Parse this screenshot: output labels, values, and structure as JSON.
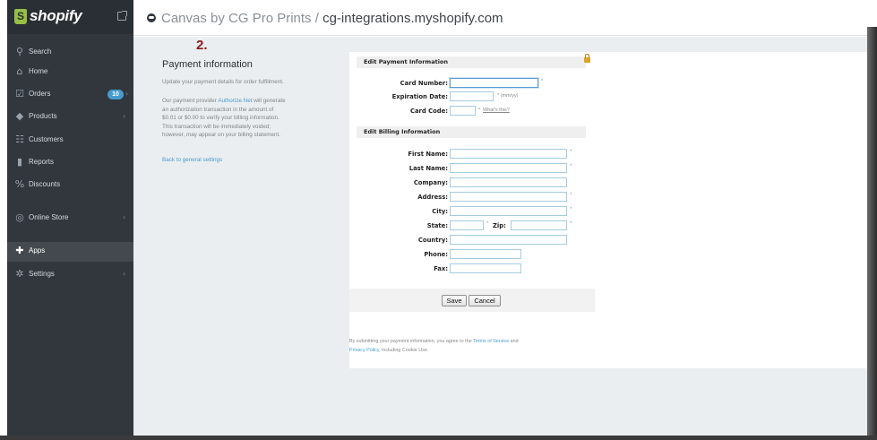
{
  "brand": {
    "name": "shopify",
    "bag_letter": "S"
  },
  "sidebar": {
    "items": [
      {
        "icon": "search-icon",
        "glyph": "⚲",
        "label": "Search"
      },
      {
        "icon": "home-icon",
        "glyph": "⌂",
        "label": "Home"
      },
      {
        "icon": "orders-icon",
        "glyph": "☑",
        "label": "Orders",
        "badge": "10"
      },
      {
        "icon": "products-icon",
        "glyph": "◆",
        "label": "Products"
      },
      {
        "icon": "customers-icon",
        "glyph": "☷",
        "label": "Customers"
      },
      {
        "icon": "reports-icon",
        "glyph": "▮",
        "label": "Reports"
      },
      {
        "icon": "discounts-icon",
        "glyph": "%",
        "label": "Discounts"
      },
      {
        "icon": "online-store-icon",
        "glyph": "◎",
        "label": "Online Store"
      },
      {
        "icon": "apps-icon",
        "glyph": "✚",
        "label": "Apps",
        "active": true
      },
      {
        "icon": "settings-icon",
        "glyph": "✲",
        "label": "Settings"
      }
    ]
  },
  "header": {
    "store_name": "Canvas by CG Pro Prints",
    "separator": " / ",
    "app_name": "cg-integrations.myshopify.com"
  },
  "main": {
    "step": "2.",
    "title": "Payment information",
    "desc1": "Update your payment details for order fulfillment.",
    "desc2_a": "Our payment provider ",
    "desc2_link": "Authorize.Net",
    "desc2_b": " will generate",
    "desc2_line2": "an authorization transaction in the amount of",
    "desc2_line3": "$0.01 or $0.00 to verify your billing information.",
    "desc2_line4": "This transaction will be immediately voided;",
    "desc2_line5": "however, may appear on your billing statement.",
    "back_link": "Back to general settings"
  },
  "form": {
    "payment_header": "Edit Payment Information",
    "card_number_label": "Card Number:",
    "expiration_label": "Expiration Date:",
    "expiration_hint": "* (mm/yy)",
    "card_code_label": "Card Code:",
    "whats_this": "What's this?",
    "billing_header": "Edit Billing Information",
    "first_name_label": "First Name:",
    "last_name_label": "Last Name:",
    "company_label": "Company:",
    "address_label": "Address:",
    "city_label": "City:",
    "state_label": "State:",
    "zip_label": "Zip:",
    "country_label": "Country:",
    "phone_label": "Phone:",
    "fax_label": "Fax:",
    "required_mark": "*",
    "save_label": "Save",
    "cancel_label": "Cancel",
    "legal_a": "By submitting your payment information, you agree to the ",
    "legal_terms": "Terms of Service",
    "legal_b": " and",
    "legal_privacy": "Privacy Policy",
    "legal_c": ", including Cookie Use."
  },
  "colors": {
    "sidebar": "#31373d",
    "accent": "#479ccf",
    "step": "#8b1a1a",
    "brand_bag": "#95bf47"
  }
}
